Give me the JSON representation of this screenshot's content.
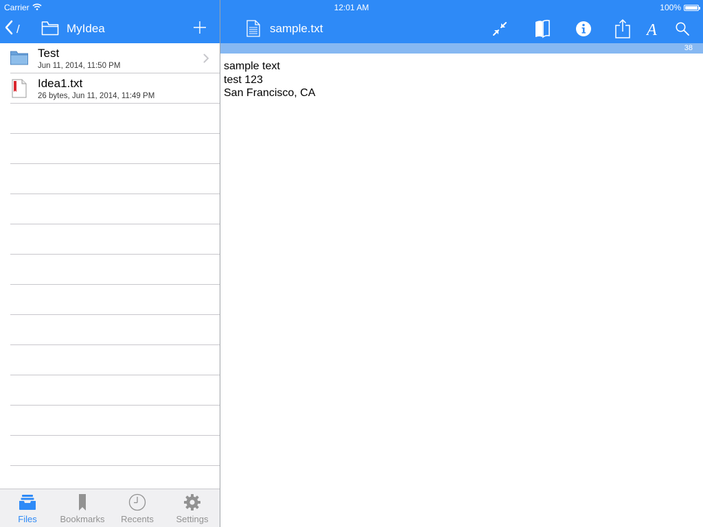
{
  "status_bar": {
    "carrier": "Carrier",
    "time": "12:01 AM",
    "battery": "100%",
    "battery_level": 1.0
  },
  "left_nav": {
    "path": "/",
    "title": "MyIdea",
    "back_icon": "chevron-left-icon",
    "folder_icon": "folder-outline-icon",
    "add_icon": "plus-icon"
  },
  "right_nav": {
    "title": "sample.txt",
    "doc_icon": "document-icon",
    "tools": [
      "collapse-arrows-icon",
      "book-icon",
      "info-icon",
      "share-icon",
      "font-icon",
      "search-icon"
    ]
  },
  "line_bar": {
    "count": "38"
  },
  "editor": {
    "lines": [
      "sample text",
      "test 123",
      "San Francisco, CA"
    ]
  },
  "files": [
    {
      "name": "Test",
      "detail": "Jun 11, 2014, 11:50 PM",
      "kind": "folder"
    },
    {
      "name": "Idea1.txt",
      "detail": "26 bytes, Jun 11, 2014, 11:49 PM",
      "kind": "text-file"
    }
  ],
  "tabs": [
    {
      "label": "Files",
      "icon": "files-tray-icon",
      "active": true
    },
    {
      "label": "Bookmarks",
      "icon": "bookmark-icon",
      "active": false
    },
    {
      "label": "Recents",
      "icon": "clock-icon",
      "active": false
    },
    {
      "label": "Settings",
      "icon": "gear-icon",
      "active": false
    }
  ],
  "colors": {
    "accent": "#2e8af7",
    "line_bar": "#86b8f2",
    "tab_inactive": "#929292",
    "tab_bar_bg": "#f0f0f2"
  }
}
